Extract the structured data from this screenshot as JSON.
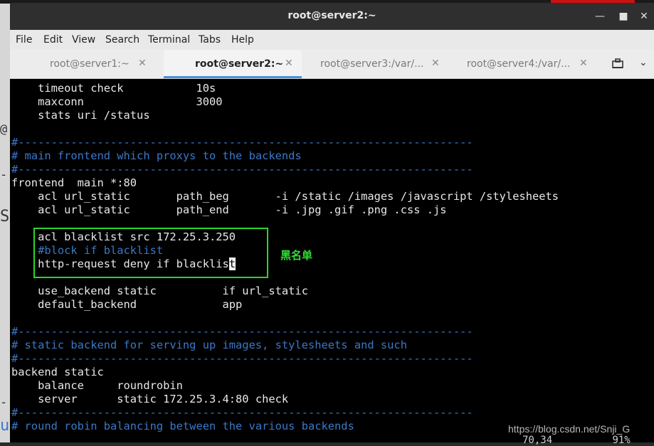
{
  "window": {
    "title": "root@server2:~"
  },
  "menu": [
    "File",
    "Edit",
    "View",
    "Search",
    "Terminal",
    "Tabs",
    "Help"
  ],
  "tabs": [
    {
      "label": "root@server1:~"
    },
    {
      "label": "root@server2:~"
    },
    {
      "label": "root@server3:/var/..."
    },
    {
      "label": "root@server4:/var/..."
    }
  ],
  "terminal": {
    "lines": [
      "    timeout check           10s",
      "    maxconn                 3000",
      "    stats uri /status",
      "",
      "#---------------------------------------------------------------------",
      "# main frontend which proxys to the backends",
      "#---------------------------------------------------------------------",
      "frontend  main *:80",
      "    acl url_static       path_beg       -i /static /images /javascript /stylesheets",
      "    acl url_static       path_end       -i .jpg .gif .png .css .js",
      "",
      "    acl blacklist src 172.25.3.250",
      "    #block if blacklist",
      "    http-request deny if blacklis",
      "",
      "    use_backend static          if url_static",
      "    default_backend             app",
      "",
      "#---------------------------------------------------------------------",
      "# static backend for serving up images, stylesheets and such",
      "#---------------------------------------------------------------------",
      "backend static",
      "    balance     roundrobin",
      "    server      static 172.25.3.4:80 check",
      "#---------------------------------------------------------------------",
      "# round robin balancing between the various backends"
    ],
    "cursor_char": "t",
    "annotation": "黑名单",
    "status_pos": "70,34",
    "status_pct": "91%"
  },
  "watermark": "https://blog.csdn.net/Snji_G",
  "desktop_fragments": [
    "@",
    "-",
    "S",
    "-",
    "u"
  ]
}
